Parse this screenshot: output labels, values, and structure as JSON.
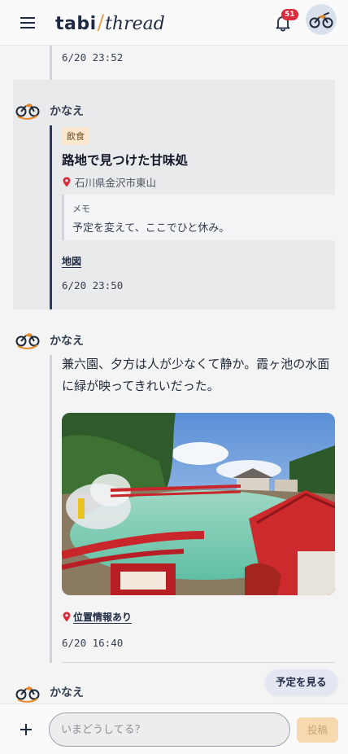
{
  "header": {
    "logo_part1": "tabi",
    "logo_slash": "/",
    "logo_part2": "thread",
    "notification_count": "51"
  },
  "icons": {
    "menu": "hamburger-icon",
    "bell": "bell-icon",
    "avatar": "motorcycle-icon",
    "pin": "map-pin-icon",
    "plus": "plus-icon"
  },
  "colors": {
    "brand_navy": "#1f2a44",
    "accent_orange": "#e0a050",
    "badge_red": "#d92b3a",
    "active_thread": "#2d3a66"
  },
  "posts": [
    {
      "timestamp": "6/20 23:52"
    },
    {
      "author": "かなえ",
      "category": "飲食",
      "title": "路地で見つけた甘味処",
      "location": "石川県金沢市東山",
      "memo_label": "メモ",
      "memo_text": "予定を変えて、ここでひと休み。",
      "map_link": "地図",
      "timestamp": "6/20 23:50"
    },
    {
      "author": "かなえ",
      "text_line1": "兼六園、夕方は人が少なくて静か。霞ヶ池の水面",
      "text_line2": "に緑が映ってきれいだった。",
      "geo_link": "位置情報あり",
      "timestamp": "6/20 16:40"
    },
    {
      "author": "かなえ"
    }
  ],
  "schedule_button": "予定を見る",
  "composer": {
    "placeholder": "いまどうしてる？",
    "post_button": "投稿"
  }
}
